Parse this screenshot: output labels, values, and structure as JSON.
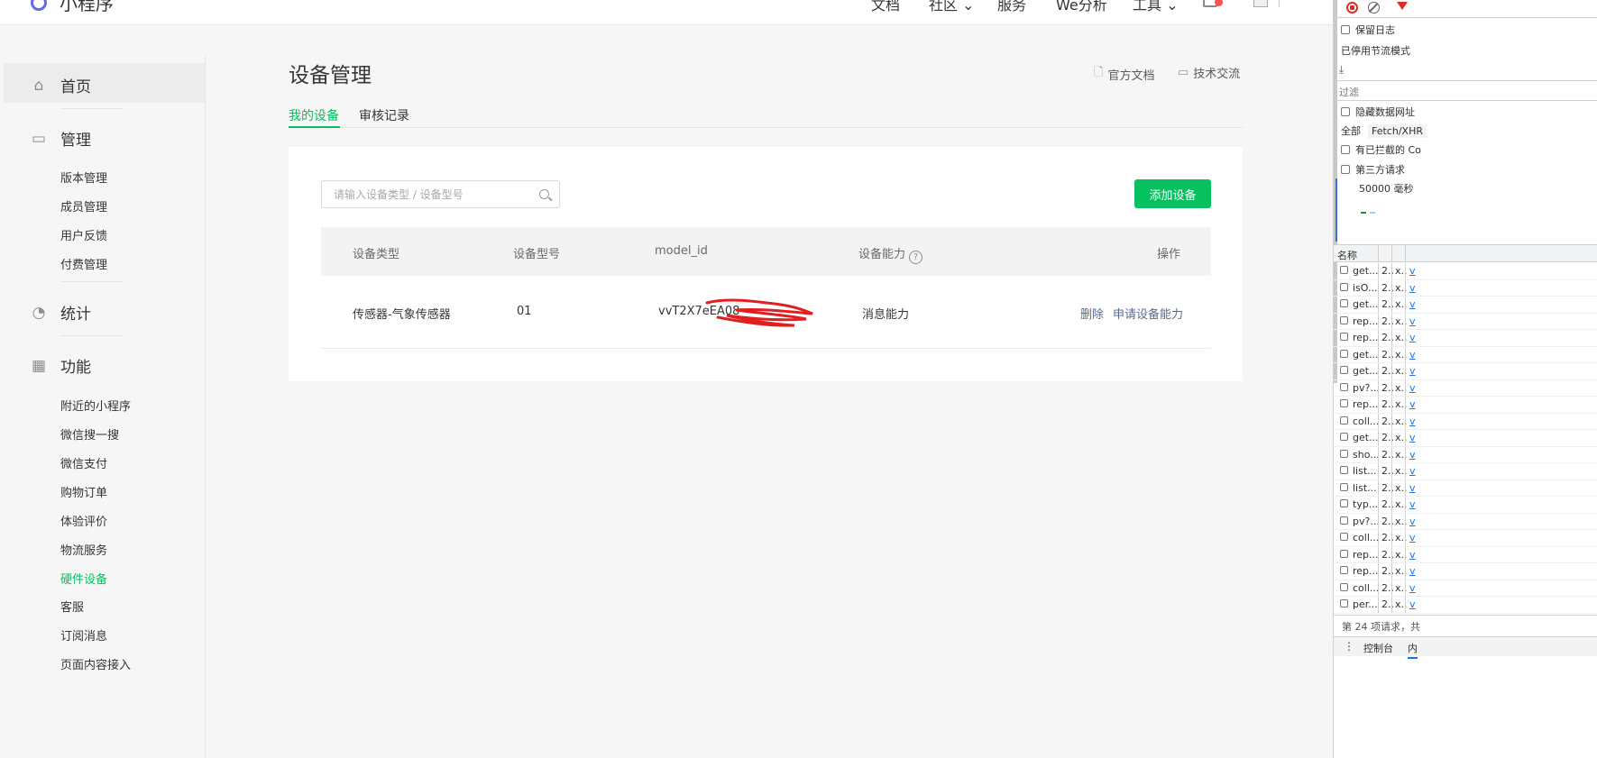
{
  "topbar": {
    "logo_text": "小程序",
    "nav": [
      "文档",
      "社区",
      "服务",
      "We分析",
      "工具"
    ],
    "accent": "#07c160"
  },
  "sidebar": {
    "sections": [
      {
        "label": "首页",
        "icon": "home-icon"
      },
      {
        "label": "管理",
        "icon": "inbox-icon"
      },
      {
        "label": "统计",
        "icon": "pie-chart-icon"
      },
      {
        "label": "功能",
        "icon": "grid-icon"
      }
    ],
    "manage_items": [
      "版本管理",
      "成员管理",
      "用户反馈",
      "付费管理"
    ],
    "feature_items": [
      "附近的小程序",
      "微信搜一搜",
      "微信支付",
      "购物订单",
      "体验评价",
      "物流服务",
      "硬件设备",
      "客服",
      "订阅消息",
      "页面内容接入"
    ],
    "active_item": "硬件设备"
  },
  "main": {
    "title": "设备管理",
    "doc_link": "官方文档",
    "tech_link": "技术交流",
    "tabs": [
      {
        "label": "我的设备",
        "active": true
      },
      {
        "label": "审核记录",
        "active": false
      }
    ],
    "search": {
      "placeholder": "请输入设备类型 / 设备型号",
      "value": ""
    },
    "add_button": "添加设备",
    "table": {
      "headers": [
        "设备类型",
        "设备型号",
        "model_id",
        "设备能力",
        "操作"
      ],
      "rows": [
        {
          "type": "传感器-气象传感器",
          "model": "01",
          "model_id": "vvT2X7eEA08",
          "capability": "消息能力",
          "actions": [
            "删除",
            "申请设备能力"
          ]
        }
      ]
    }
  },
  "devtools": {
    "preserve_log": "保留日志",
    "throttle_disabled": "已停用节流模式",
    "filter_placeholder": "过滤",
    "hide_data_urls": "隐藏数据网址",
    "all_label": "全部",
    "fetch_xhr": "Fetch/XHR",
    "blocked": "有已拦截的 Co",
    "third_party": "第三方请求",
    "timeline_label": "50000 毫秒",
    "col_name": "名称",
    "requests": [
      "get...",
      "isO...",
      "get...",
      "rep...",
      "rep...",
      "get...",
      "get...",
      "pv?...",
      "rep...",
      "coll...",
      "get...",
      "sho...",
      "list...",
      "list...",
      "typ...",
      "pv?...",
      "coll...",
      "rep...",
      "rep...",
      "coll...",
      "per..."
    ],
    "req_col2": "2..",
    "req_col3": "x..",
    "req_col4": "v",
    "status": "第 24 项请求，共",
    "drawer_console": "控制台",
    "drawer_other": "内"
  }
}
